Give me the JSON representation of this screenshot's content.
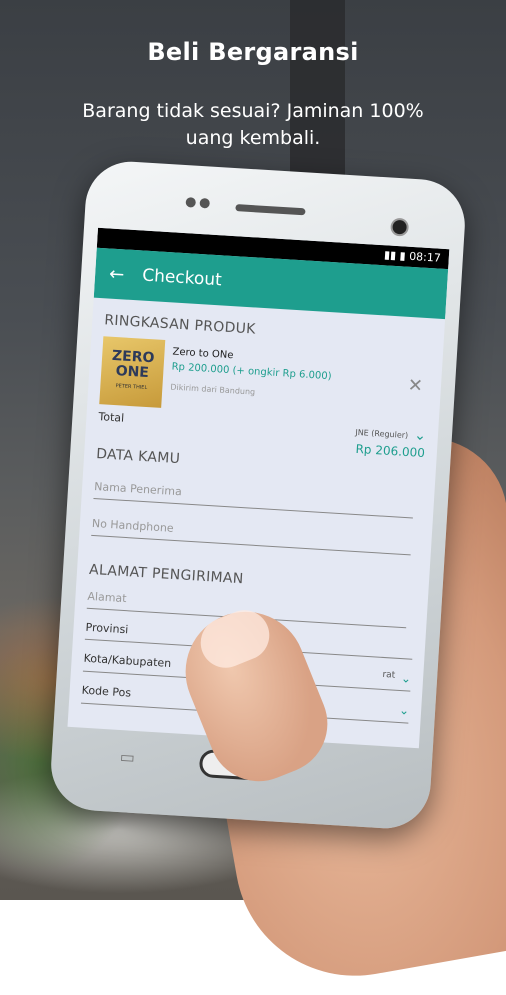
{
  "promo": {
    "title": "Beli Bergaransi",
    "subtitle_line1": "Barang tidak sesuai? Jaminan 100%",
    "subtitle_line2": "uang kembali."
  },
  "statusbar": {
    "time": "08:17"
  },
  "appbar": {
    "back_icon": "←",
    "title": "Checkout"
  },
  "product_summary": {
    "heading": "RINGKASAN PRODUK",
    "cover_line1": "ZERO",
    "cover_line2": "ONE",
    "cover_author": "PETER THIEL",
    "name": "Zero to ONe",
    "price": "Rp 200.000 (+ ongkir Rp 6.000)",
    "origin": "Dikirim dari Bandung",
    "remove_icon": "✕",
    "total_label": "Total",
    "courier": "JNE (Reguler)",
    "total_value": "Rp 206.000"
  },
  "buyer": {
    "heading": "DATA KAMU",
    "name_placeholder": "Nama Penerima",
    "phone_placeholder": "No Handphone"
  },
  "shipping": {
    "heading": "ALAMAT PENGIRIMAN",
    "address_placeholder": "Alamat",
    "province_label": "Provinsi",
    "city_label": "Kota/Kabupaten",
    "city_value": "rat",
    "postal_label": "Kode Pos"
  },
  "icons": {
    "chevron": "chevron-down-icon",
    "back": "arrow-back-icon",
    "close": "close-icon"
  },
  "colors": {
    "accent": "#1e9e8e"
  }
}
